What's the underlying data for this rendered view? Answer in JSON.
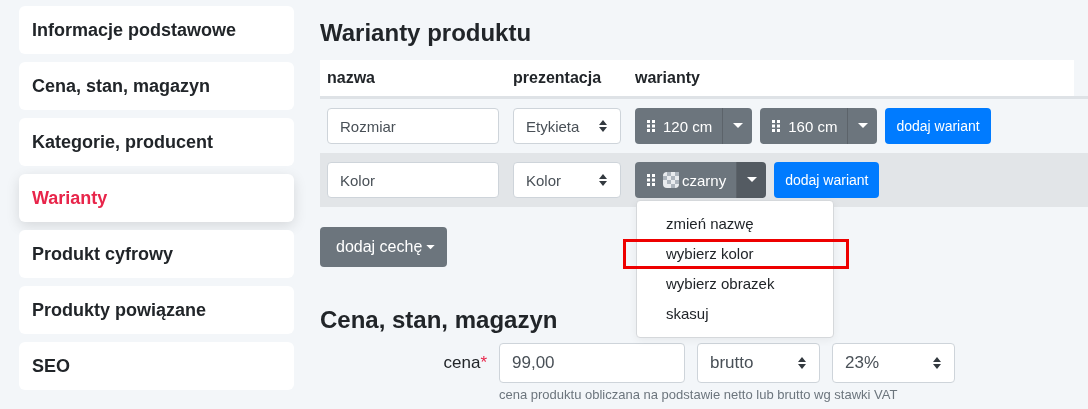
{
  "sidebar": {
    "items": [
      {
        "label": "Informacje podstawowe",
        "selected": false
      },
      {
        "label": "Cena, stan, magazyn",
        "selected": false
      },
      {
        "label": "Kategorie, producent",
        "selected": false
      },
      {
        "label": "Warianty",
        "selected": true
      },
      {
        "label": "Produkt cyfrowy",
        "selected": false
      },
      {
        "label": "Produkty powiązane",
        "selected": false
      },
      {
        "label": "SEO",
        "selected": false
      }
    ]
  },
  "variants_section": {
    "title": "Warianty produktu",
    "table": {
      "columns": [
        "nazwa",
        "prezentacja",
        "warianty"
      ],
      "rows": [
        {
          "name": "Rozmiar",
          "presentation": "Etykieta",
          "highlighted": false,
          "variants": [
            {
              "label": "120 cm",
              "kind": "label",
              "open": false
            },
            {
              "label": "160 cm",
              "kind": "label",
              "open": false
            }
          ],
          "add_button": "dodaj wariant"
        },
        {
          "name": "Kolor",
          "presentation": "Kolor",
          "highlighted": true,
          "variants": [
            {
              "label": "czarny",
              "kind": "swatch",
              "open": true,
              "menu": [
                {
                  "label": "zmień nazwę",
                  "highlighted": false
                },
                {
                  "label": "wybierz kolor",
                  "highlighted": true
                },
                {
                  "label": "wybierz obrazek",
                  "highlighted": false
                },
                {
                  "label": "skasuj",
                  "highlighted": false
                }
              ]
            }
          ],
          "add_button": "dodaj wariant"
        }
      ]
    },
    "add_feature_button": "dodaj cechę"
  },
  "price_section": {
    "title": "Cena, stan, magazyn",
    "price_label": "cena",
    "required_mark": "*",
    "price_value": "99,00",
    "price_type": "brutto",
    "vat": "23%",
    "help_text": "cena produktu obliczana na podstawie netto lub brutto wg stawki VAT"
  }
}
